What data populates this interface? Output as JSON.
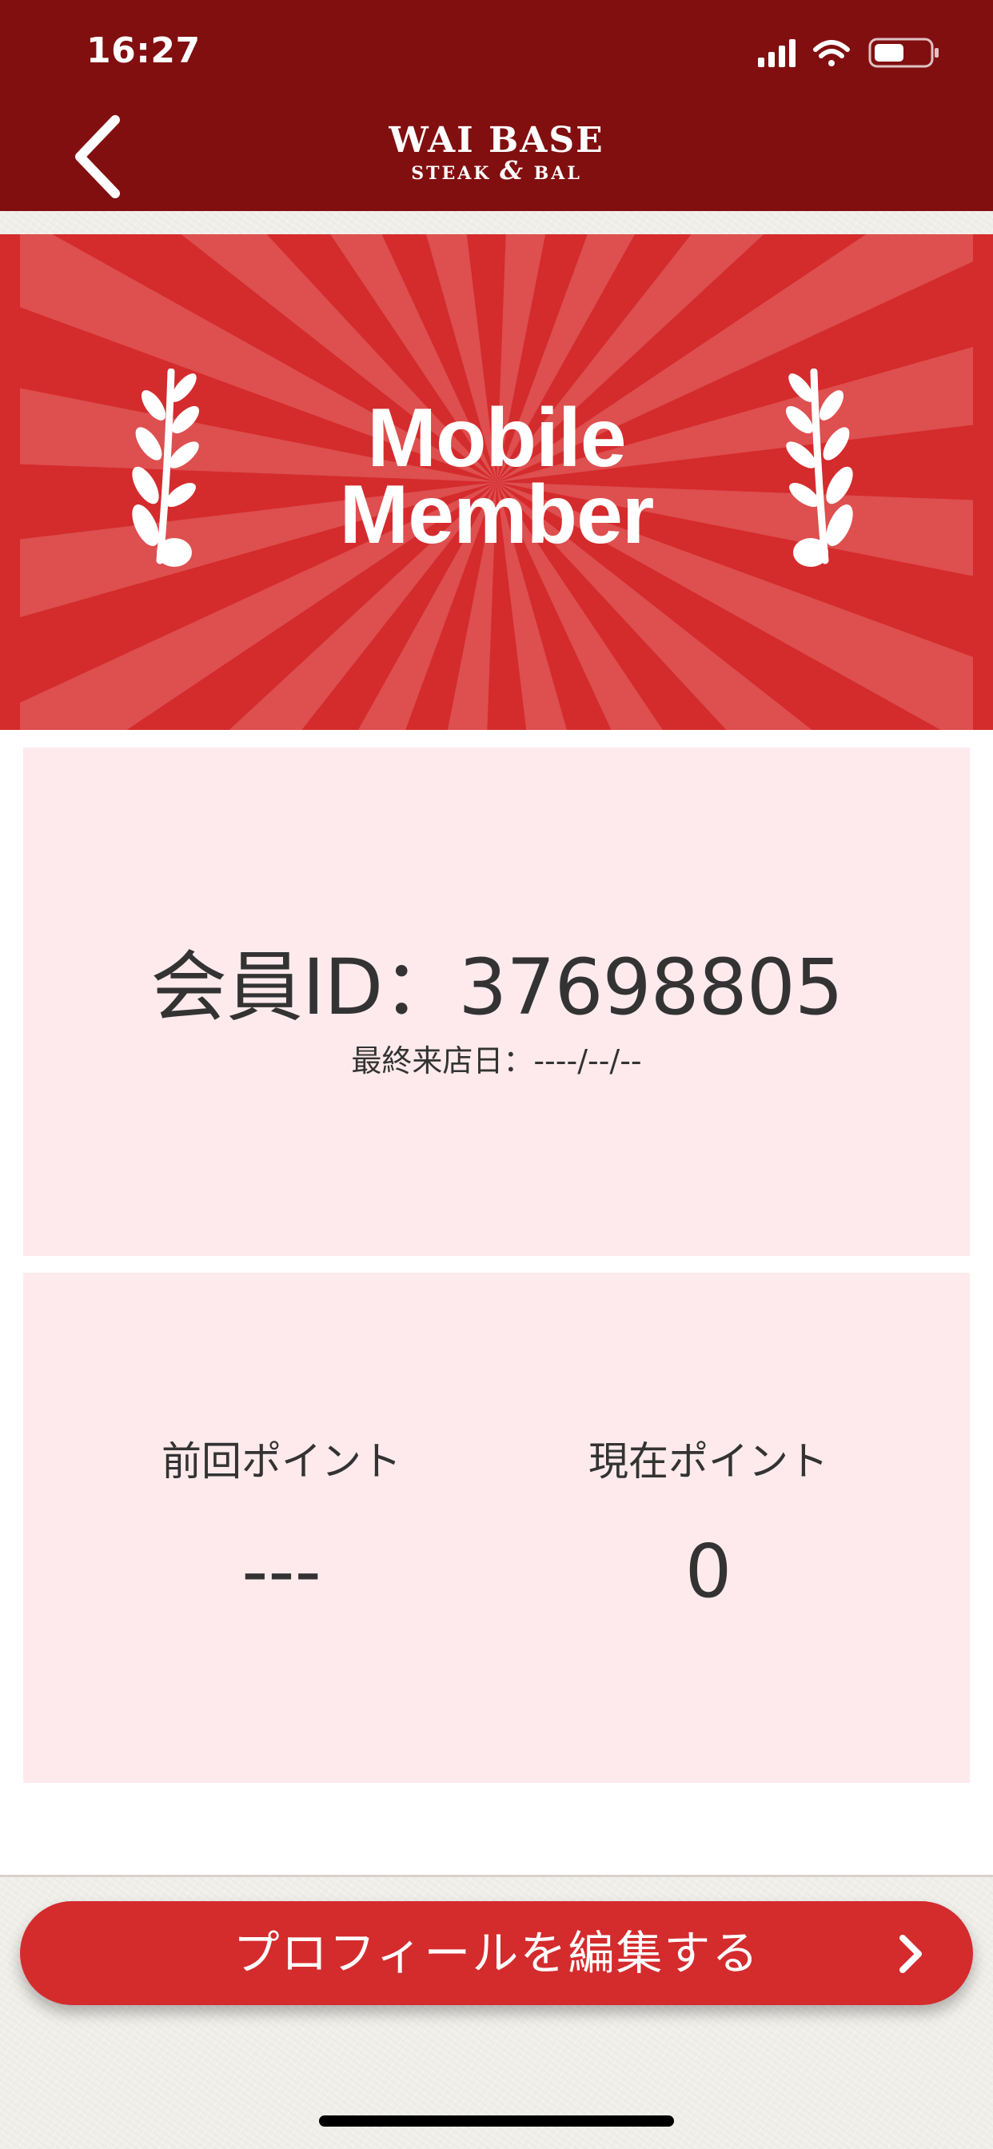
{
  "status_bar": {
    "time": "16:27"
  },
  "header": {
    "logo_main": "WAI BASE",
    "logo_sub_left": "STEAK",
    "logo_sub_amp": "&",
    "logo_sub_right": "BAL",
    "icons": {
      "back": "chevron-left-icon",
      "signal": "signal-icon",
      "wifi": "wifi-icon",
      "battery": "battery-icon"
    }
  },
  "banner": {
    "title_line1": "Mobile",
    "title_line2": "Member",
    "colors": {
      "base": "#d42b2d",
      "ray": "#e05656"
    },
    "icons": [
      "laurel-left-icon",
      "laurel-right-icon"
    ]
  },
  "member_card": {
    "id_text": "会員ID：37698805",
    "last_visit_text": "最終来店日：----/--/--"
  },
  "points_card": {
    "previous_label": "前回ポイント",
    "previous_value": "---",
    "current_label": "現在ポイント",
    "current_value": "0"
  },
  "footer": {
    "edit_profile_label": "プロフィールを編集する",
    "chevron_icon": "chevron-right-icon"
  },
  "colors": {
    "header_bg": "#810f10",
    "accent_red": "#d42b2d",
    "card_bg": "#feeaed",
    "text_dark": "#333333",
    "page_bg": "#f1efea"
  }
}
